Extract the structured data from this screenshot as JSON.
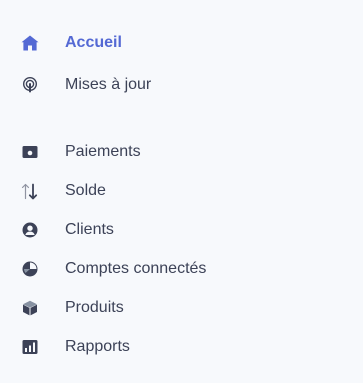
{
  "sidebar": {
    "colors": {
      "active": "#5469d4",
      "text": "#3c4257",
      "icon": "#3c4257",
      "background": "#f7f9fc"
    },
    "items": [
      {
        "label": "Accueil",
        "icon": "home-icon",
        "active": true
      },
      {
        "label": "Mises à jour",
        "icon": "broadcast-icon",
        "active": false
      },
      {
        "label": "Paiements",
        "icon": "wallet-icon",
        "active": false
      },
      {
        "label": "Solde",
        "icon": "transfer-arrows-icon",
        "active": false
      },
      {
        "label": "Clients",
        "icon": "user-circle-icon",
        "active": false
      },
      {
        "label": "Comptes connectés",
        "icon": "connected-accounts-icon",
        "active": false
      },
      {
        "label": "Produits",
        "icon": "box-icon",
        "active": false
      },
      {
        "label": "Rapports",
        "icon": "reports-icon",
        "active": false
      }
    ]
  }
}
